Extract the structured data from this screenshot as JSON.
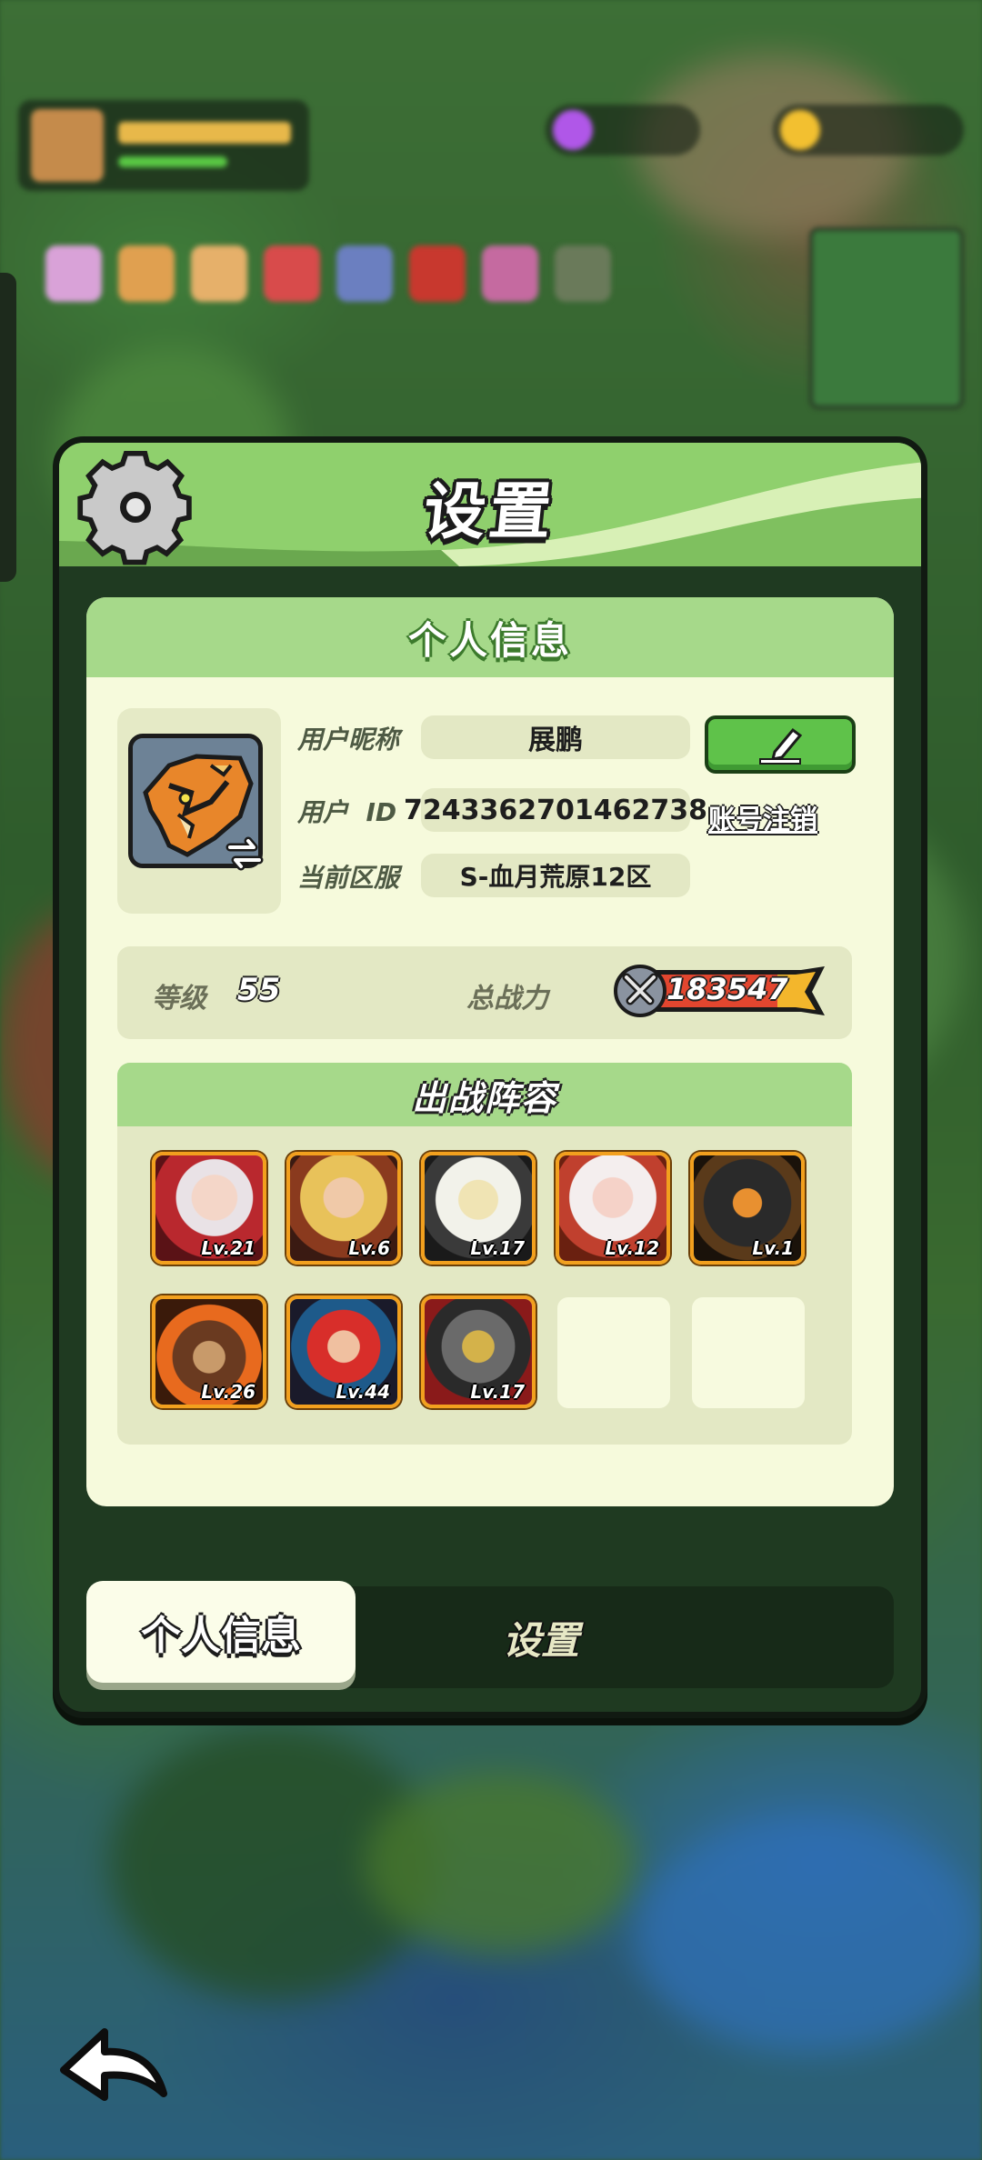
{
  "modal": {
    "title": "设置",
    "section_title": "个人信息"
  },
  "profile": {
    "nickname_label": "用户昵称",
    "nickname": "展鹏",
    "id_label": "用户  ID",
    "user_id": "7243362701462738",
    "server_label": "当前区服",
    "server": "S-血月荒原12区",
    "delete_account": "账号注销"
  },
  "stats": {
    "level_label": "等级",
    "level": "55",
    "power_label": "总战力",
    "power": "183547"
  },
  "lineup": {
    "title": "出战阵容",
    "heroes": [
      {
        "level": "Lv.21"
      },
      {
        "level": "Lv.6"
      },
      {
        "level": "Lv.17"
      },
      {
        "level": "Lv.12"
      },
      {
        "level": "Lv.1"
      },
      {
        "level": "Lv.26"
      },
      {
        "level": "Lv.44"
      },
      {
        "level": "Lv.17"
      }
    ],
    "empty_slots": 2
  },
  "tabs": {
    "active": "个人信息",
    "inactive": "设置"
  },
  "colors": {
    "header_green": "#7fc05f",
    "panel_cream": "#f6fadc",
    "edit_button": "#5fc24a",
    "hero_border": "#f2a01e"
  },
  "icons": [
    "gear-icon",
    "pencil-icon",
    "swap-icon",
    "sword-icon",
    "back-arrow-icon"
  ]
}
